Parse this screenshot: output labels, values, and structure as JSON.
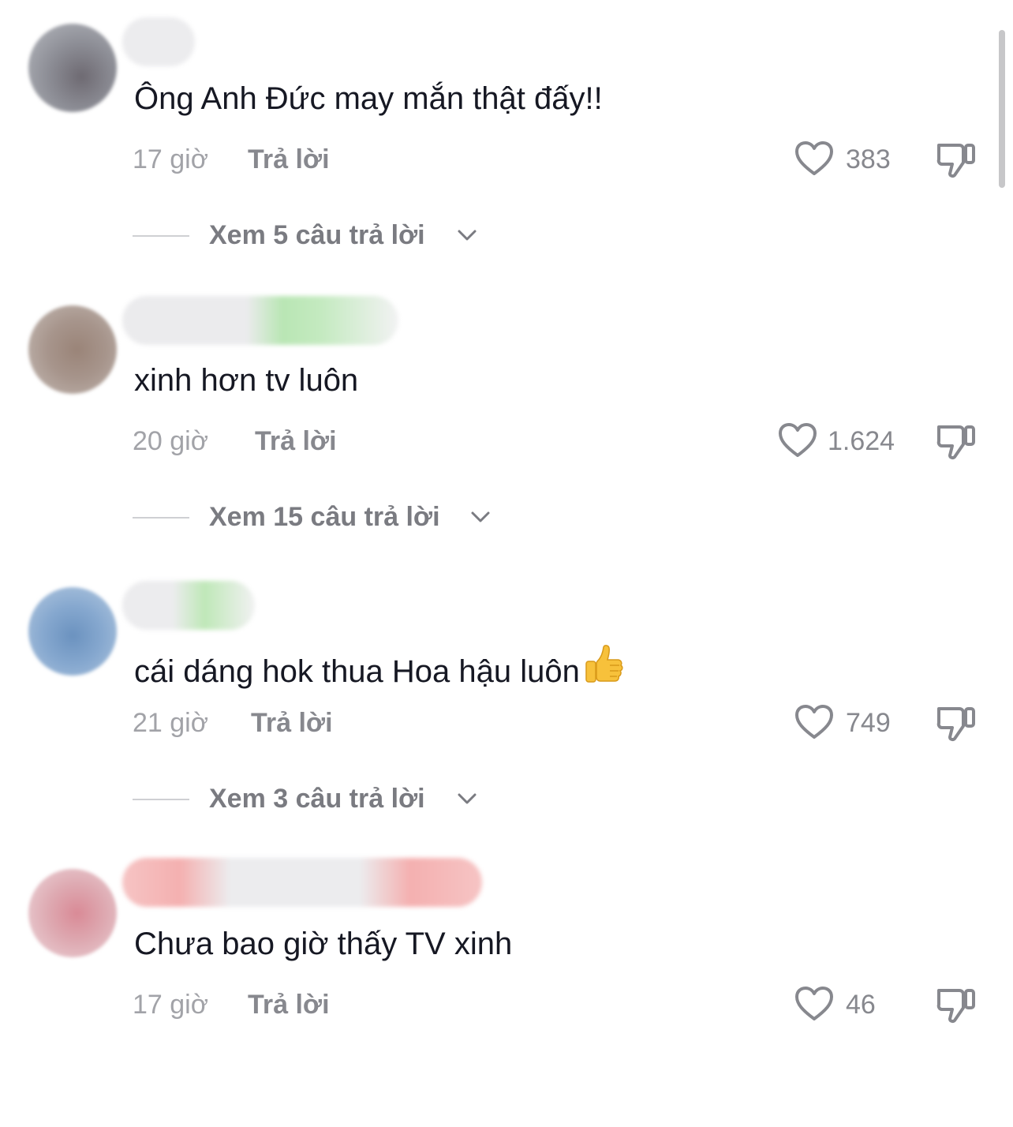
{
  "comments": [
    {
      "text": "Ông Anh Đức may mắn thật đấy!!",
      "time": "17 giờ",
      "reply_label": "Trả lời",
      "likes": "383",
      "view_replies": "Xem 5 câu trả lời",
      "avatar_color": "#8a8a92",
      "emoji": ""
    },
    {
      "text": "xinh hơn tv luôn",
      "time": "20 giờ",
      "reply_label": "Trả lời",
      "likes": "1.624",
      "view_replies": "Xem 15 câu trả lời",
      "avatar_color": "#a09088",
      "emoji": ""
    },
    {
      "text": "cái dáng hok thua Hoa hậu luôn",
      "time": "21 giờ",
      "reply_label": "Trả lời",
      "likes": "749",
      "view_replies": "Xem 3 câu trả lời",
      "avatar_color": "#7ea2c8",
      "emoji": "thumbs-up-emoji"
    },
    {
      "text": "Chưa bao giờ thấy TV xinh",
      "time": "17 giờ",
      "reply_label": "Trả lời",
      "likes": "46",
      "view_replies": "",
      "avatar_color": "#d4a8b0",
      "emoji": ""
    }
  ],
  "icons": {
    "like": "heart-outline-icon",
    "dislike": "thumbs-down-outline-icon",
    "expand": "chevron-down-icon"
  },
  "colors": {
    "text": "#161823",
    "secondary": "#a2a3a8",
    "action": "#87888e"
  }
}
